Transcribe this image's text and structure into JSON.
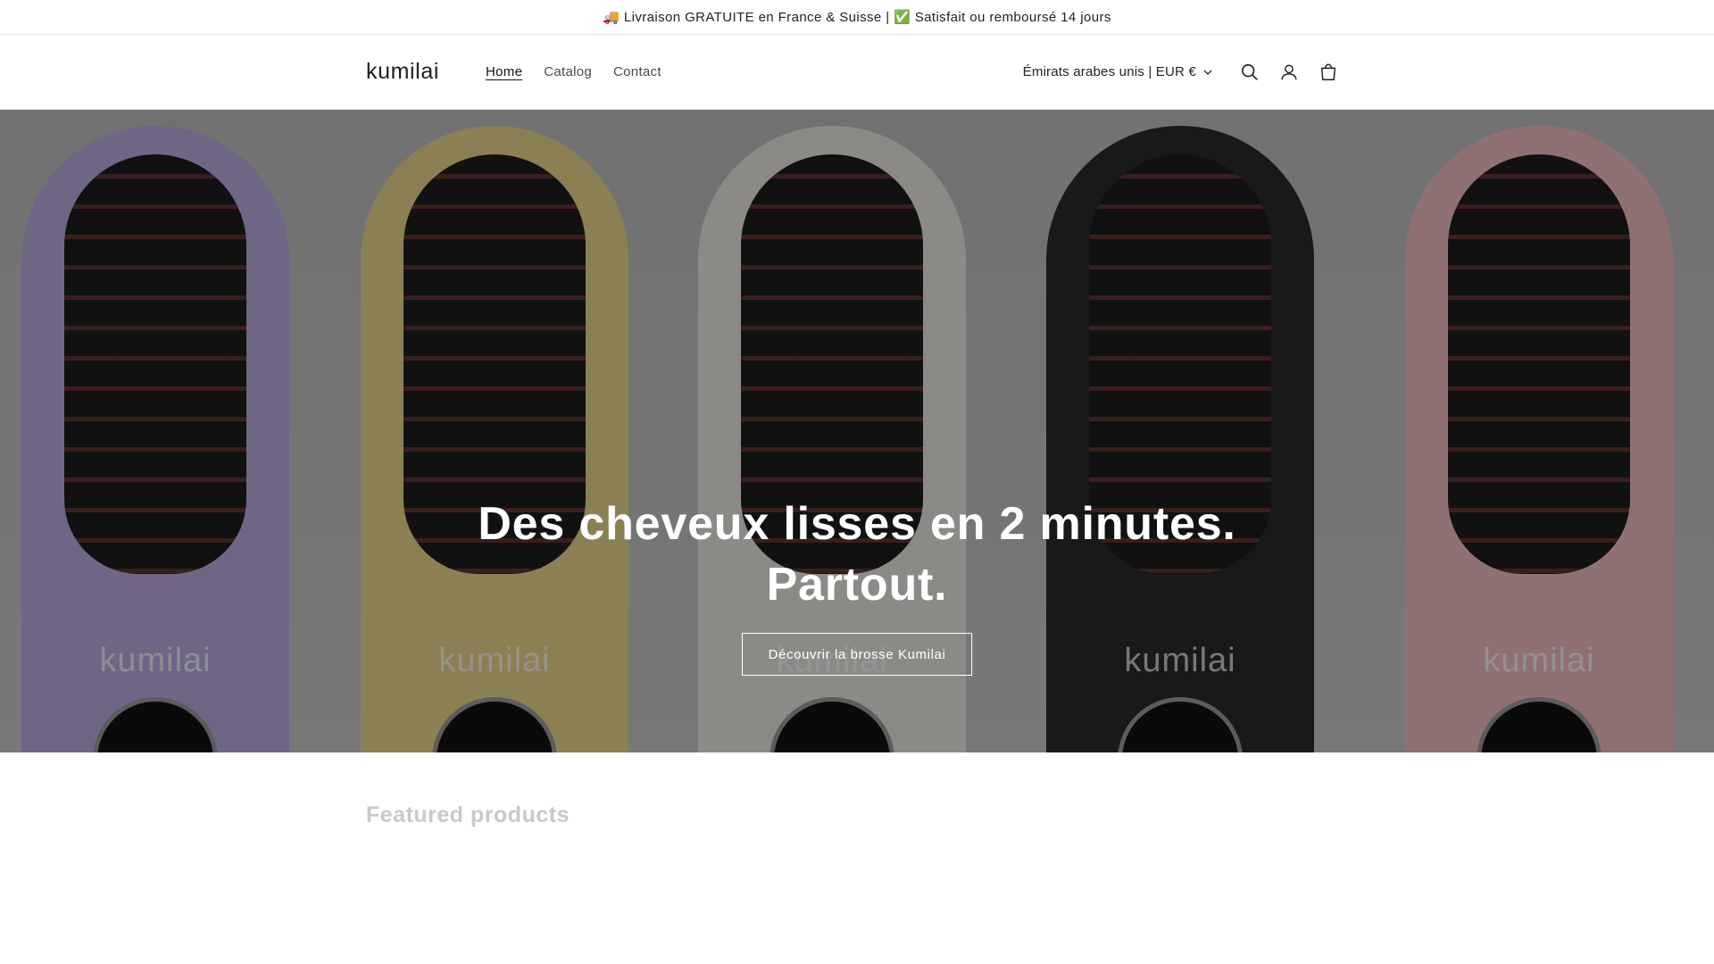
{
  "announcement": {
    "text": "🚚 Livraison GRATUITE en France & Suisse | ✅ Satisfait ou remboursé 14 jours"
  },
  "header": {
    "logo": "kumilai",
    "nav": [
      {
        "label": "Home",
        "active": true
      },
      {
        "label": "Catalog",
        "active": false
      },
      {
        "label": "Contact",
        "active": false
      }
    ],
    "localization": "Émirats arabes unis | EUR €",
    "icons": [
      "search-icon",
      "account-icon",
      "cart-icon"
    ]
  },
  "hero": {
    "title_line1": "Des cheveux lisses en 2 minutes.",
    "title_line2": "Partout.",
    "button_label": "Découvrir la brosse Kumilai",
    "brush_brand": "kumilai",
    "brush_colors": [
      "#b9abe0",
      "#e7d58a",
      "#e9e7e2",
      "#2a2a2a",
      "#eebdc0"
    ]
  },
  "featured": {
    "title": "Featured products"
  }
}
